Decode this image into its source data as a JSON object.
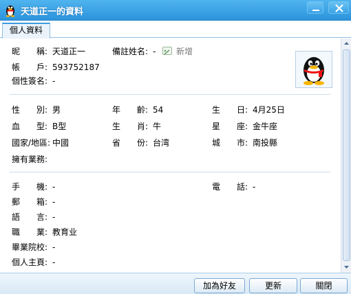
{
  "window": {
    "title": "天道正一的資料"
  },
  "tabs": [
    {
      "label": "個人資料",
      "active": true
    }
  ],
  "profile": {
    "nickname_label": "昵　　稱:",
    "nickname": "天道正一",
    "remark_label": "備註姓名:",
    "remark": "-",
    "add_label": "新增",
    "account_label": "帳　　戶:",
    "account": "593752187",
    "signature_label": "個性簽名:",
    "signature": "-"
  },
  "basic": {
    "gender_label": "性　　別:",
    "gender": "男",
    "age_label": "年　　齡:",
    "age": "54",
    "birthday_label": "生　　日:",
    "birthday": "4月25日",
    "blood_label": "血　　型:",
    "blood": "B型",
    "zodiac_label": "生　　肖:",
    "zodiac": "牛",
    "constellation_label": "星　　座:",
    "constellation": "金牛座",
    "country_label": "國家/地區:",
    "country": "中國",
    "province_label": "省　　份:",
    "province": "台湾",
    "city_label": "城　　市:",
    "city": "南投縣",
    "services_label": "擁有業務:",
    "services": ""
  },
  "contact": {
    "mobile_label": "手　　機:",
    "mobile": "-",
    "phone_label": "電　　話:",
    "phone": "-",
    "email_label": "郵　　箱:",
    "email": "-",
    "language_label": "語　　言:",
    "language": "-",
    "occupation_label": "職　　業:",
    "occupation": "教育业",
    "school_label": "畢業院校:",
    "school": "-",
    "homepage_label": "個人主頁:",
    "homepage": "-"
  },
  "footer": {
    "add_friend": "加為好友",
    "refresh": "更新",
    "close": "關閉"
  },
  "colors": {
    "titlebar": "#2c94dd",
    "accent": "#3c9be0",
    "separator": "#c8dff1"
  },
  "icons": {
    "title": "qq-penguin-icon",
    "add": "add-remark-icon",
    "avatar": "qq-penguin-avatar"
  }
}
